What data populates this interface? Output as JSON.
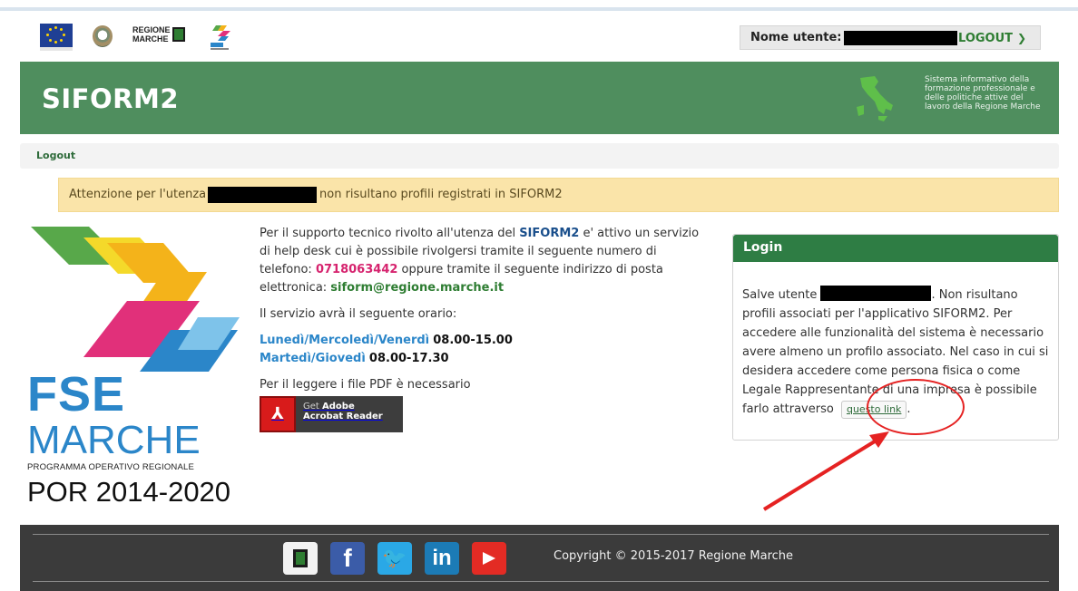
{
  "header_logos": {
    "region_name": "REGIONE MARCHE"
  },
  "user": {
    "label": "Nome utente:",
    "logout_label": "LOGOUT",
    "logout_icon": "chevron-right-icon"
  },
  "banner": {
    "title": "SIFORM2",
    "description": "Sistema informativo della formazione professionale e delle politiche attive del lavoro della Regione Marche"
  },
  "breadcrumb": {
    "logout": "Logout"
  },
  "alert": {
    "prefix": "Attenzione per l'utenza",
    "suffix": "non risultano profili registrati in SIFORM2"
  },
  "big_logo": {
    "line1": "FSE",
    "line2": "MARCHE",
    "line3": "PROGRAMMA OPERATIVO REGIONALE",
    "line4": "POR 2014-2020"
  },
  "info": {
    "p1_a": "Per il supporto tecnico rivolto all'utenza del ",
    "p1_brand": "SIFORM2",
    "p1_b": " e' attivo un servizio di help desk cui è possibile rivolgersi tramite il seguente numero di telefono: ",
    "p1_phone": "0718063442",
    "p1_c": " oppure tramite il seguente indirizzo di posta elettronica: ",
    "p1_mail": "siform@regione.marche.it",
    "p2": "Il servizio avrà il seguente orario:",
    "sched1_days": "Lunedì/Mercoledì/Venerdì",
    "sched1_hours": "08.00-15.00",
    "sched2_days": "Martedì/Giovedì",
    "sched2_hours": "08.00-17.30",
    "p3": "Per il leggere i file PDF è necessario",
    "adobe_get": "Get",
    "adobe_name": "Adobe",
    "adobe_product": "Acrobat Reader"
  },
  "login": {
    "title": "Login",
    "text_a": "Salve utente",
    "text_b": ". Non risultano profili associati per l'applicativo SIFORM2. Per accedere alle funzionalità del sistema è necessario avere almeno un profilo associato. Nel caso in cui si desidera accedere come persona fisica o come Legale Rappresentante di una impresa è possibile farlo attraverso",
    "link_label": "questo link",
    "text_end": "."
  },
  "footer": {
    "copyright": "Copyright © 2015-2017 Regione Marche",
    "social_icons": [
      "regione-marche-icon",
      "facebook-icon",
      "twitter-icon",
      "linkedin-icon",
      "youtube-icon"
    ]
  },
  "colors": {
    "header_green": "#4f8e5e",
    "login_green": "#2e7d44",
    "alert_bg": "#fae4a9",
    "footer_bg": "#3b3b3b",
    "annotation_red": "#e52222"
  }
}
